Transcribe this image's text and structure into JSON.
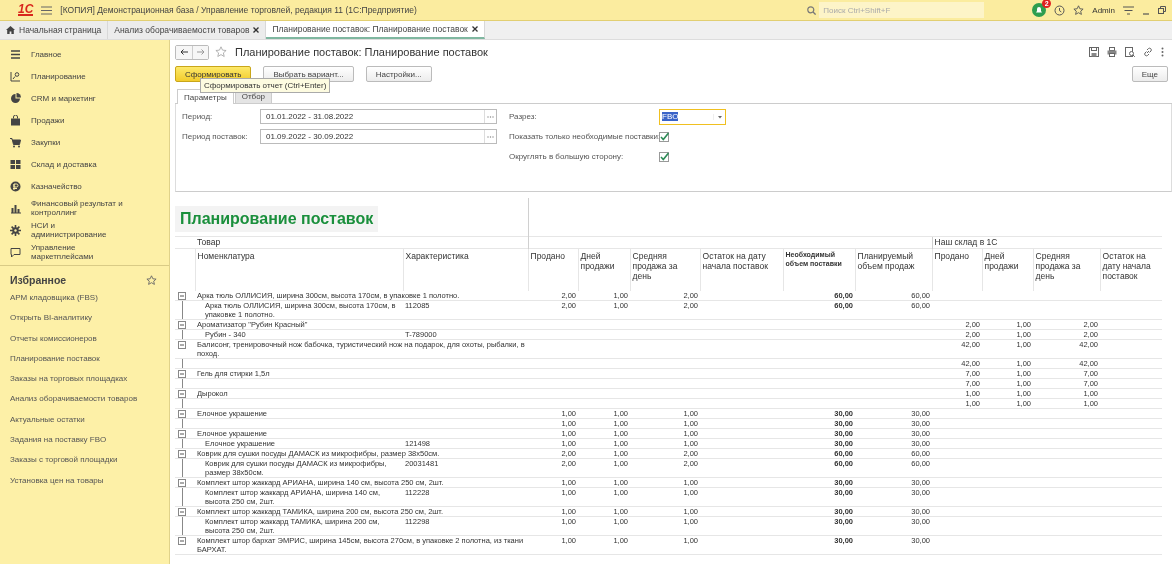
{
  "window": {
    "logo": "1С",
    "title": "[КОПИЯ] Демонстрационная база / Управление торговлей, редакция 11  (1С:Предприятие)",
    "search_placeholder": "Поиск Ctrl+Shift+F",
    "notifications": "2",
    "user": "Admin"
  },
  "tabs": [
    {
      "label": "Начальная страница",
      "kind": "home",
      "closable": false,
      "selected": false
    },
    {
      "label": "Анализ оборачиваемости товаров",
      "kind": "page",
      "closable": true,
      "selected": false
    },
    {
      "label": "Планирование поставок: Планирование поставок",
      "kind": "page",
      "closable": true,
      "selected": true
    }
  ],
  "sidebar": {
    "sections": [
      {
        "label": "Главное",
        "kind": "menu"
      },
      {
        "label": "Планирование",
        "kind": "planning"
      },
      {
        "label": "CRM и маркетинг",
        "kind": "pie"
      },
      {
        "label": "Продажи",
        "kind": "bag"
      },
      {
        "label": "Закупки",
        "kind": "cart"
      },
      {
        "label": "Склад и доставка",
        "kind": "grid"
      },
      {
        "label": "Казначейство",
        "kind": "coin"
      },
      {
        "label": "Финансовый результат и контроллинг",
        "kind": "bars"
      },
      {
        "label": "НСИ и администрирование",
        "kind": "gear"
      },
      {
        "label": "Управление маркетплейсами",
        "kind": "chat"
      }
    ],
    "favorites": {
      "title": "Избранное",
      "items": [
        "АРМ кладовщика (FBS)",
        "Открыть BI-аналитику",
        "Отчеты комиссионеров",
        "Планирование поставок",
        "Заказы на торговых площадках",
        "Анализ оборачиваемости товаров",
        "Актуальные остатки",
        "Задания на поставку FBO",
        "Заказы с торговой площадки",
        "Установка цен на товары"
      ]
    }
  },
  "form": {
    "title": "Планирование поставок: Планирование поставок",
    "buttons": [
      {
        "label": "Сформировать",
        "kind": "default"
      },
      {
        "label": "Выбрать вариант...",
        "kind": "normal"
      },
      {
        "label": "Настройки...",
        "kind": "normal"
      }
    ],
    "more_button": "Еще",
    "tooltip": "Сформировать отчет (Ctrl+Enter)",
    "tabs": [
      {
        "label": "Параметры",
        "selected": true
      },
      {
        "label": "Отбор",
        "selected": false
      }
    ],
    "fields": [
      {
        "label": "Период:",
        "value": "01.01.2022 - 31.08.2022"
      },
      {
        "label": "Период поставок:",
        "value": "01.09.2022 - 30.09.2022"
      }
    ],
    "slice": {
      "label": "Разрез:",
      "value": "FBO"
    },
    "checkboxes": [
      {
        "label": "Показать только необходимые поставки:",
        "checked": true
      },
      {
        "label": "Округлять в большую сторону:",
        "checked": true
      }
    ]
  },
  "report": {
    "title": "Планирование поставок",
    "product_header": {
      "label": "Товар",
      "columns": [
        {
          "label": "Номенклатура"
        },
        {
          "label": "Характеристика"
        }
      ]
    },
    "metric_columns": [
      {
        "label": "Продано",
        "bold": false
      },
      {
        "label": "Дней продажи",
        "bold": false
      },
      {
        "label": "Средняя продажа за день",
        "bold": false
      },
      {
        "label": "Остаток на дату начала поставок",
        "bold": false
      },
      {
        "label": "Необходимый объем поставки",
        "bold": true
      },
      {
        "label": "Планируемый объем продаж",
        "bold": false
      }
    ],
    "warehouse_header": {
      "label": "Наш склад в 1С",
      "columns": [
        {
          "label": "Продано"
        },
        {
          "label": "Дней продажи"
        },
        {
          "label": "Средняя продажа за день"
        },
        {
          "label": "Остаток на дату начала поставок"
        }
      ]
    },
    "rows": [
      {
        "name": "Арка тюль ОЛЛИСИЯ, ширина 300см, высота 170см, в упаковке 1 полотно.",
        "expanded": true,
        "sold": "2,00",
        "sale_days": "1,00",
        "avg_per_day": "2,00",
        "required_supply": "60,00",
        "planned_sales": "60,00",
        "children": [
          {
            "name": "Арка тюль ОЛЛИСИЯ, ширина 300см, высота 170см, в упаковке 1 полотно.",
            "characteristic": "112085",
            "sold": "2,00",
            "sale_days": "1,00",
            "avg_per_day": "2,00",
            "required_supply": "60,00",
            "planned_sales": "60,00"
          }
        ]
      },
      {
        "name": "Ароматизатор \"Рубин Красный\"",
        "expanded": true,
        "wh_sold": "2,00",
        "wh_sale_days": "1,00",
        "wh_avg_per_day": "2,00",
        "children": [
          {
            "name": "Рубин - 340",
            "characteristic": "T-789000",
            "wh_sold": "2,00",
            "wh_sale_days": "1,00",
            "wh_avg_per_day": "2,00"
          }
        ]
      },
      {
        "name": "Балисонг, тренировочный нож бабочка, туристический нож на подарок, для охоты, рыбалки, в поход.",
        "expanded": true,
        "wh_sold": "42,00",
        "wh_sale_days": "1,00",
        "wh_avg_per_day": "42,00",
        "children": [
          {
            "wh_sold": "42,00",
            "wh_sale_days": "1,00",
            "wh_avg_per_day": "42,00"
          }
        ]
      },
      {
        "name": "Гель для стирки 1,5л",
        "expanded": true,
        "wh_sold": "7,00",
        "wh_sale_days": "1,00",
        "wh_avg_per_day": "7,00",
        "children": [
          {
            "wh_sold": "7,00",
            "wh_sale_days": "1,00",
            "wh_avg_per_day": "7,00"
          }
        ]
      },
      {
        "name": "Дырокол",
        "expanded": true,
        "wh_sold": "1,00",
        "wh_sale_days": "1,00",
        "wh_avg_per_day": "1,00",
        "children": [
          {
            "wh_sold": "1,00",
            "wh_sale_days": "1,00",
            "wh_avg_per_day": "1,00"
          }
        ]
      },
      {
        "name": "Елочное украшение",
        "expanded": true,
        "sold": "1,00",
        "sale_days": "1,00",
        "avg_per_day": "1,00",
        "required_supply": "30,00",
        "planned_sales": "30,00",
        "children": [
          {
            "sold": "1,00",
            "sale_days": "1,00",
            "avg_per_day": "1,00",
            "required_supply": "30,00",
            "planned_sales": "30,00"
          }
        ]
      },
      {
        "name": "Елочное украшение",
        "expanded": true,
        "sold": "1,00",
        "sale_days": "1,00",
        "avg_per_day": "1,00",
        "required_supply": "30,00",
        "planned_sales": "30,00",
        "children": [
          {
            "name": "Елочное украшение",
            "characteristic": "121498",
            "sold": "1,00",
            "sale_days": "1,00",
            "avg_per_day": "1,00",
            "required_supply": "30,00",
            "planned_sales": "30,00"
          }
        ]
      },
      {
        "name": "Коврик для сушки посуды ДАМАСК из микрофибры, размер 38х50см.",
        "expanded": true,
        "sold": "2,00",
        "sale_days": "1,00",
        "avg_per_day": "2,00",
        "required_supply": "60,00",
        "planned_sales": "60,00",
        "children": [
          {
            "name": "Коврик для сушки посуды ДАМАСК из микрофибры, размер 38х50см.",
            "characteristic": "20031481",
            "sold": "2,00",
            "sale_days": "1,00",
            "avg_per_day": "2,00",
            "required_supply": "60,00",
            "planned_sales": "60,00"
          }
        ]
      },
      {
        "name": "Комплект штор жаккард АРИАНА, ширина 140 см, высота 250 см, 2шт.",
        "expanded": true,
        "sold": "1,00",
        "sale_days": "1,00",
        "avg_per_day": "1,00",
        "required_supply": "30,00",
        "planned_sales": "30,00",
        "children": [
          {
            "name": "Комплект штор жаккард АРИАНА, ширина 140 см, высота 250 см, 2шт.",
            "characteristic": "112228",
            "sold": "1,00",
            "sale_days": "1,00",
            "avg_per_day": "1,00",
            "required_supply": "30,00",
            "planned_sales": "30,00"
          }
        ]
      },
      {
        "name": "Комплект штор жаккард ТАМИКА, ширина 200 см, высота 250 см, 2шт.",
        "expanded": true,
        "sold": "1,00",
        "sale_days": "1,00",
        "avg_per_day": "1,00",
        "required_supply": "30,00",
        "planned_sales": "30,00",
        "children": [
          {
            "name": "Комплект штор жаккард ТАМИКА, ширина 200 см, высота 250 см, 2шт.",
            "characteristic": "112298",
            "sold": "1,00",
            "sale_days": "1,00",
            "avg_per_day": "1,00",
            "required_supply": "30,00",
            "planned_sales": "30,00"
          }
        ]
      },
      {
        "name": "Комплект штор бархат ЭМРИС, ширина 145см, высота 270см, в упаковке 2 полотна, из ткани БАРХАТ.",
        "expanded": true,
        "sold": "1,00",
        "sale_days": "1,00",
        "avg_per_day": "1,00",
        "required_supply": "30,00",
        "planned_sales": "30,00"
      }
    ]
  }
}
